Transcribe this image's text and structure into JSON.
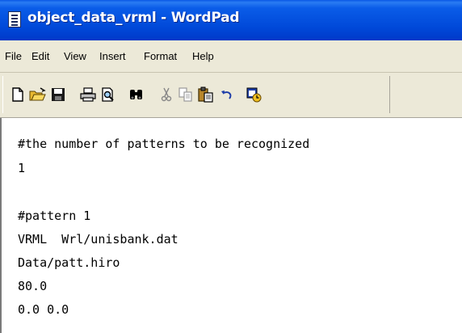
{
  "window": {
    "title": "object_data_vrml - WordPad"
  },
  "menu": {
    "items": [
      "File",
      "Edit",
      "View",
      "Insert",
      "Format",
      "Help"
    ]
  },
  "toolbar": {
    "buttons": [
      "new-document-icon",
      "open-folder-icon",
      "save-disk-icon",
      "print-icon",
      "print-preview-icon",
      "find-binoculars-icon",
      "cut-scissors-icon",
      "copy-icon",
      "paste-icon",
      "undo-icon",
      "date-time-icon"
    ]
  },
  "document": {
    "lines": [
      "#the number of patterns to be recognized",
      "1",
      "",
      "#pattern 1",
      "VRML  Wrl/unisbank.dat",
      "Data/patt.hiro",
      "80.0",
      "0.0 0.0"
    ]
  }
}
